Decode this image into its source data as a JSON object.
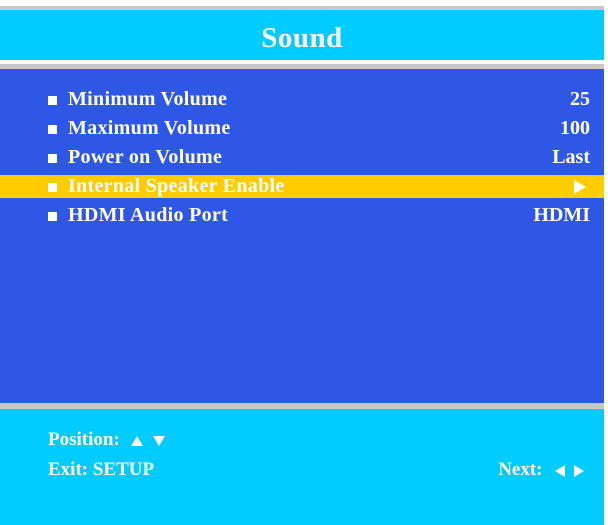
{
  "header": {
    "title": "Sound"
  },
  "menu": {
    "items": [
      {
        "label": "Minimum Volume",
        "value": "25",
        "selected": false
      },
      {
        "label": "Maximum Volume",
        "value": "100",
        "selected": false
      },
      {
        "label": "Power on Volume",
        "value": "Last",
        "selected": false
      },
      {
        "label": "Internal Speaker Enable",
        "value": "",
        "value_icon": "arrow-right-icon",
        "selected": true
      },
      {
        "label": "HDMI Audio Port",
        "value": "HDMI",
        "selected": false
      }
    ]
  },
  "footer": {
    "position_label": "Position:",
    "position_icons": [
      "arrow-up-icon",
      "arrow-down-icon"
    ],
    "exit_label": "Exit: SETUP",
    "next_label": "Next:",
    "next_icons": [
      "arrow-left-icon",
      "arrow-right-icon"
    ]
  },
  "colors": {
    "title_bar": "#00ccff",
    "main_panel": "#2e57e6",
    "selection": "#ffcc00",
    "divider": "#c8c8c8",
    "text": "#ffffff"
  }
}
